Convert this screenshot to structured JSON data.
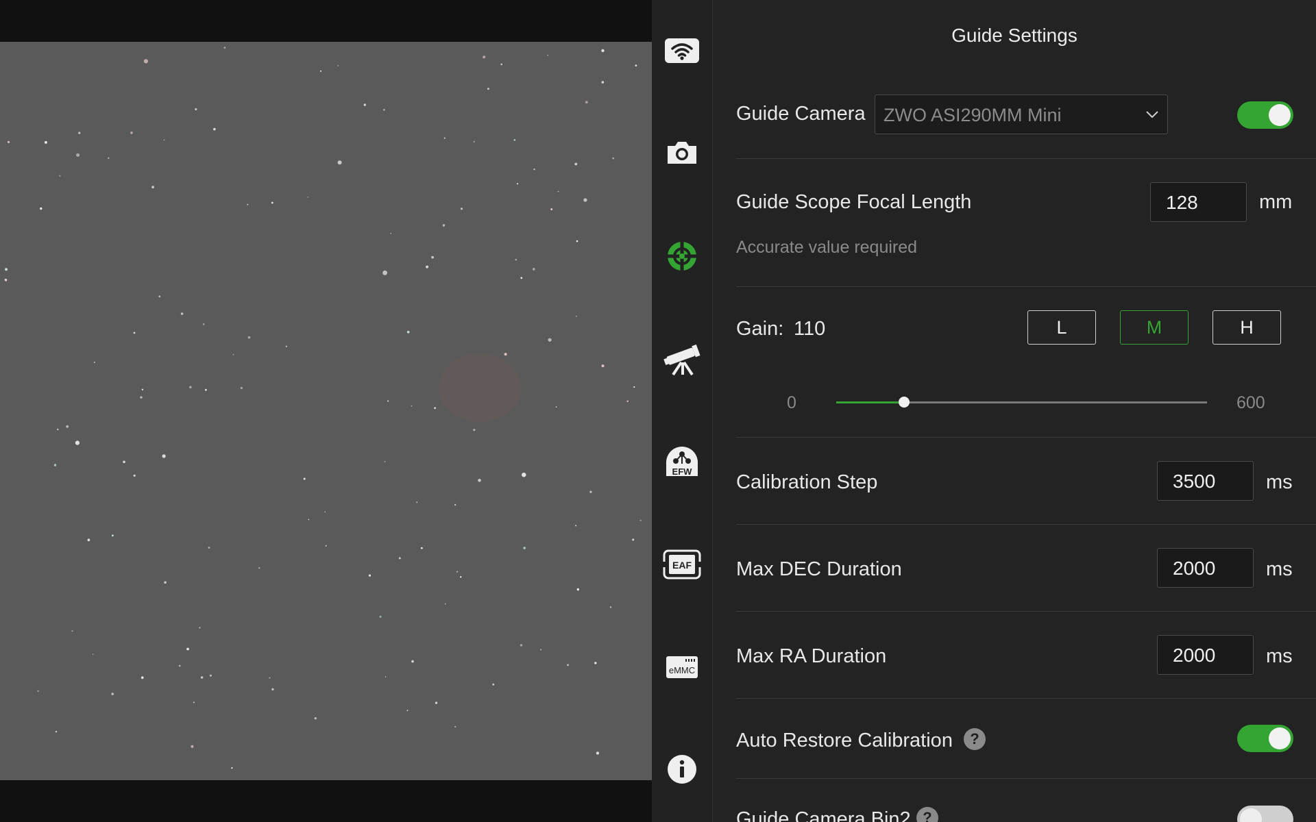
{
  "colors": {
    "accent": "#34a433",
    "panel_bg": "#232323",
    "sidebar_bg": "#222222",
    "sky_bg": "#5a5a5a"
  },
  "sidebar": {
    "items": [
      {
        "name": "wifi",
        "icon": "wifi-icon"
      },
      {
        "name": "camera",
        "icon": "camera-icon"
      },
      {
        "name": "guide",
        "icon": "crosshair-icon",
        "active": true
      },
      {
        "name": "telescope",
        "icon": "telescope-icon"
      },
      {
        "name": "efw",
        "icon": "efw-icon",
        "text": "EFW"
      },
      {
        "name": "eaf",
        "icon": "eaf-icon",
        "text": "EAF"
      },
      {
        "name": "emmc",
        "icon": "emmc-icon",
        "text": "eMMC"
      },
      {
        "name": "info",
        "icon": "info-icon"
      }
    ]
  },
  "panel": {
    "title": "Guide Settings",
    "guide_camera": {
      "label": "Guide Camera",
      "value": "ZWO ASI290MM Mini",
      "enabled": true
    },
    "focal_length": {
      "label": "Guide Scope Focal Length",
      "value": "128",
      "unit": "mm",
      "hint": "Accurate value required"
    },
    "gain": {
      "label": "Gain:",
      "value": "110",
      "presets": [
        "L",
        "M",
        "H"
      ],
      "active_preset": "M",
      "min": "0",
      "max": "600",
      "level": 110
    },
    "calibration_step": {
      "label": "Calibration Step",
      "value": "3500",
      "unit": "ms"
    },
    "max_dec": {
      "label": "Max DEC Duration",
      "value": "2000",
      "unit": "ms"
    },
    "max_ra": {
      "label": "Max RA Duration",
      "value": "2000",
      "unit": "ms"
    },
    "auto_restore": {
      "label": "Auto Restore Calibration",
      "help": "?",
      "enabled": true
    },
    "bin2": {
      "label": "Guide Camera Bin2",
      "help": "?",
      "enabled": false
    }
  }
}
